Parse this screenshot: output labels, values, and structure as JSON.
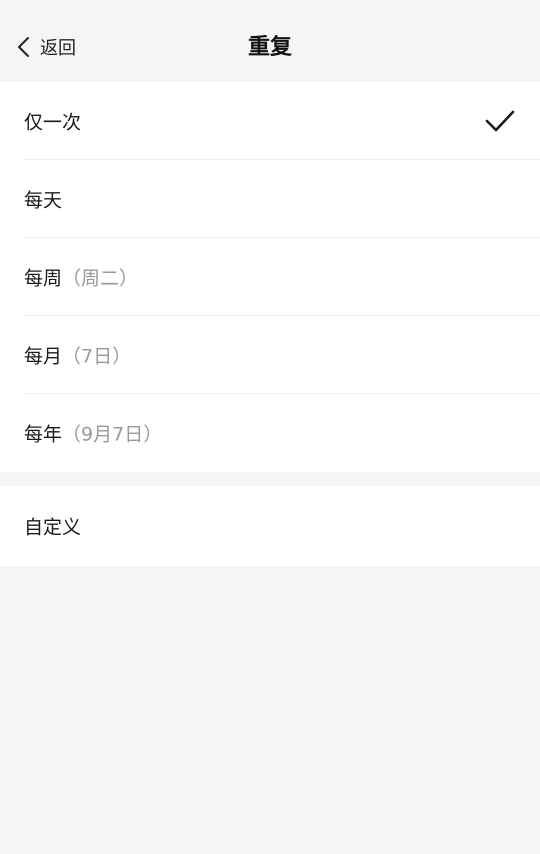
{
  "header": {
    "back_label": "返回",
    "title": "重复"
  },
  "options": [
    {
      "label": "仅一次",
      "sub": "",
      "selected": true
    },
    {
      "label": "每天",
      "sub": "",
      "selected": false
    },
    {
      "label": "每周",
      "sub": "（周二）",
      "selected": false
    },
    {
      "label": "每月",
      "sub": "（7日）",
      "selected": false
    },
    {
      "label": "每年",
      "sub": "（9月7日）",
      "selected": false
    }
  ],
  "custom": {
    "label": "自定义"
  },
  "icons": {
    "back": "chevron-left-icon",
    "selected": "checkmark-icon"
  },
  "colors": {
    "background": "#f5f5f5",
    "card": "#ffffff",
    "secondary_text": "#999999"
  }
}
